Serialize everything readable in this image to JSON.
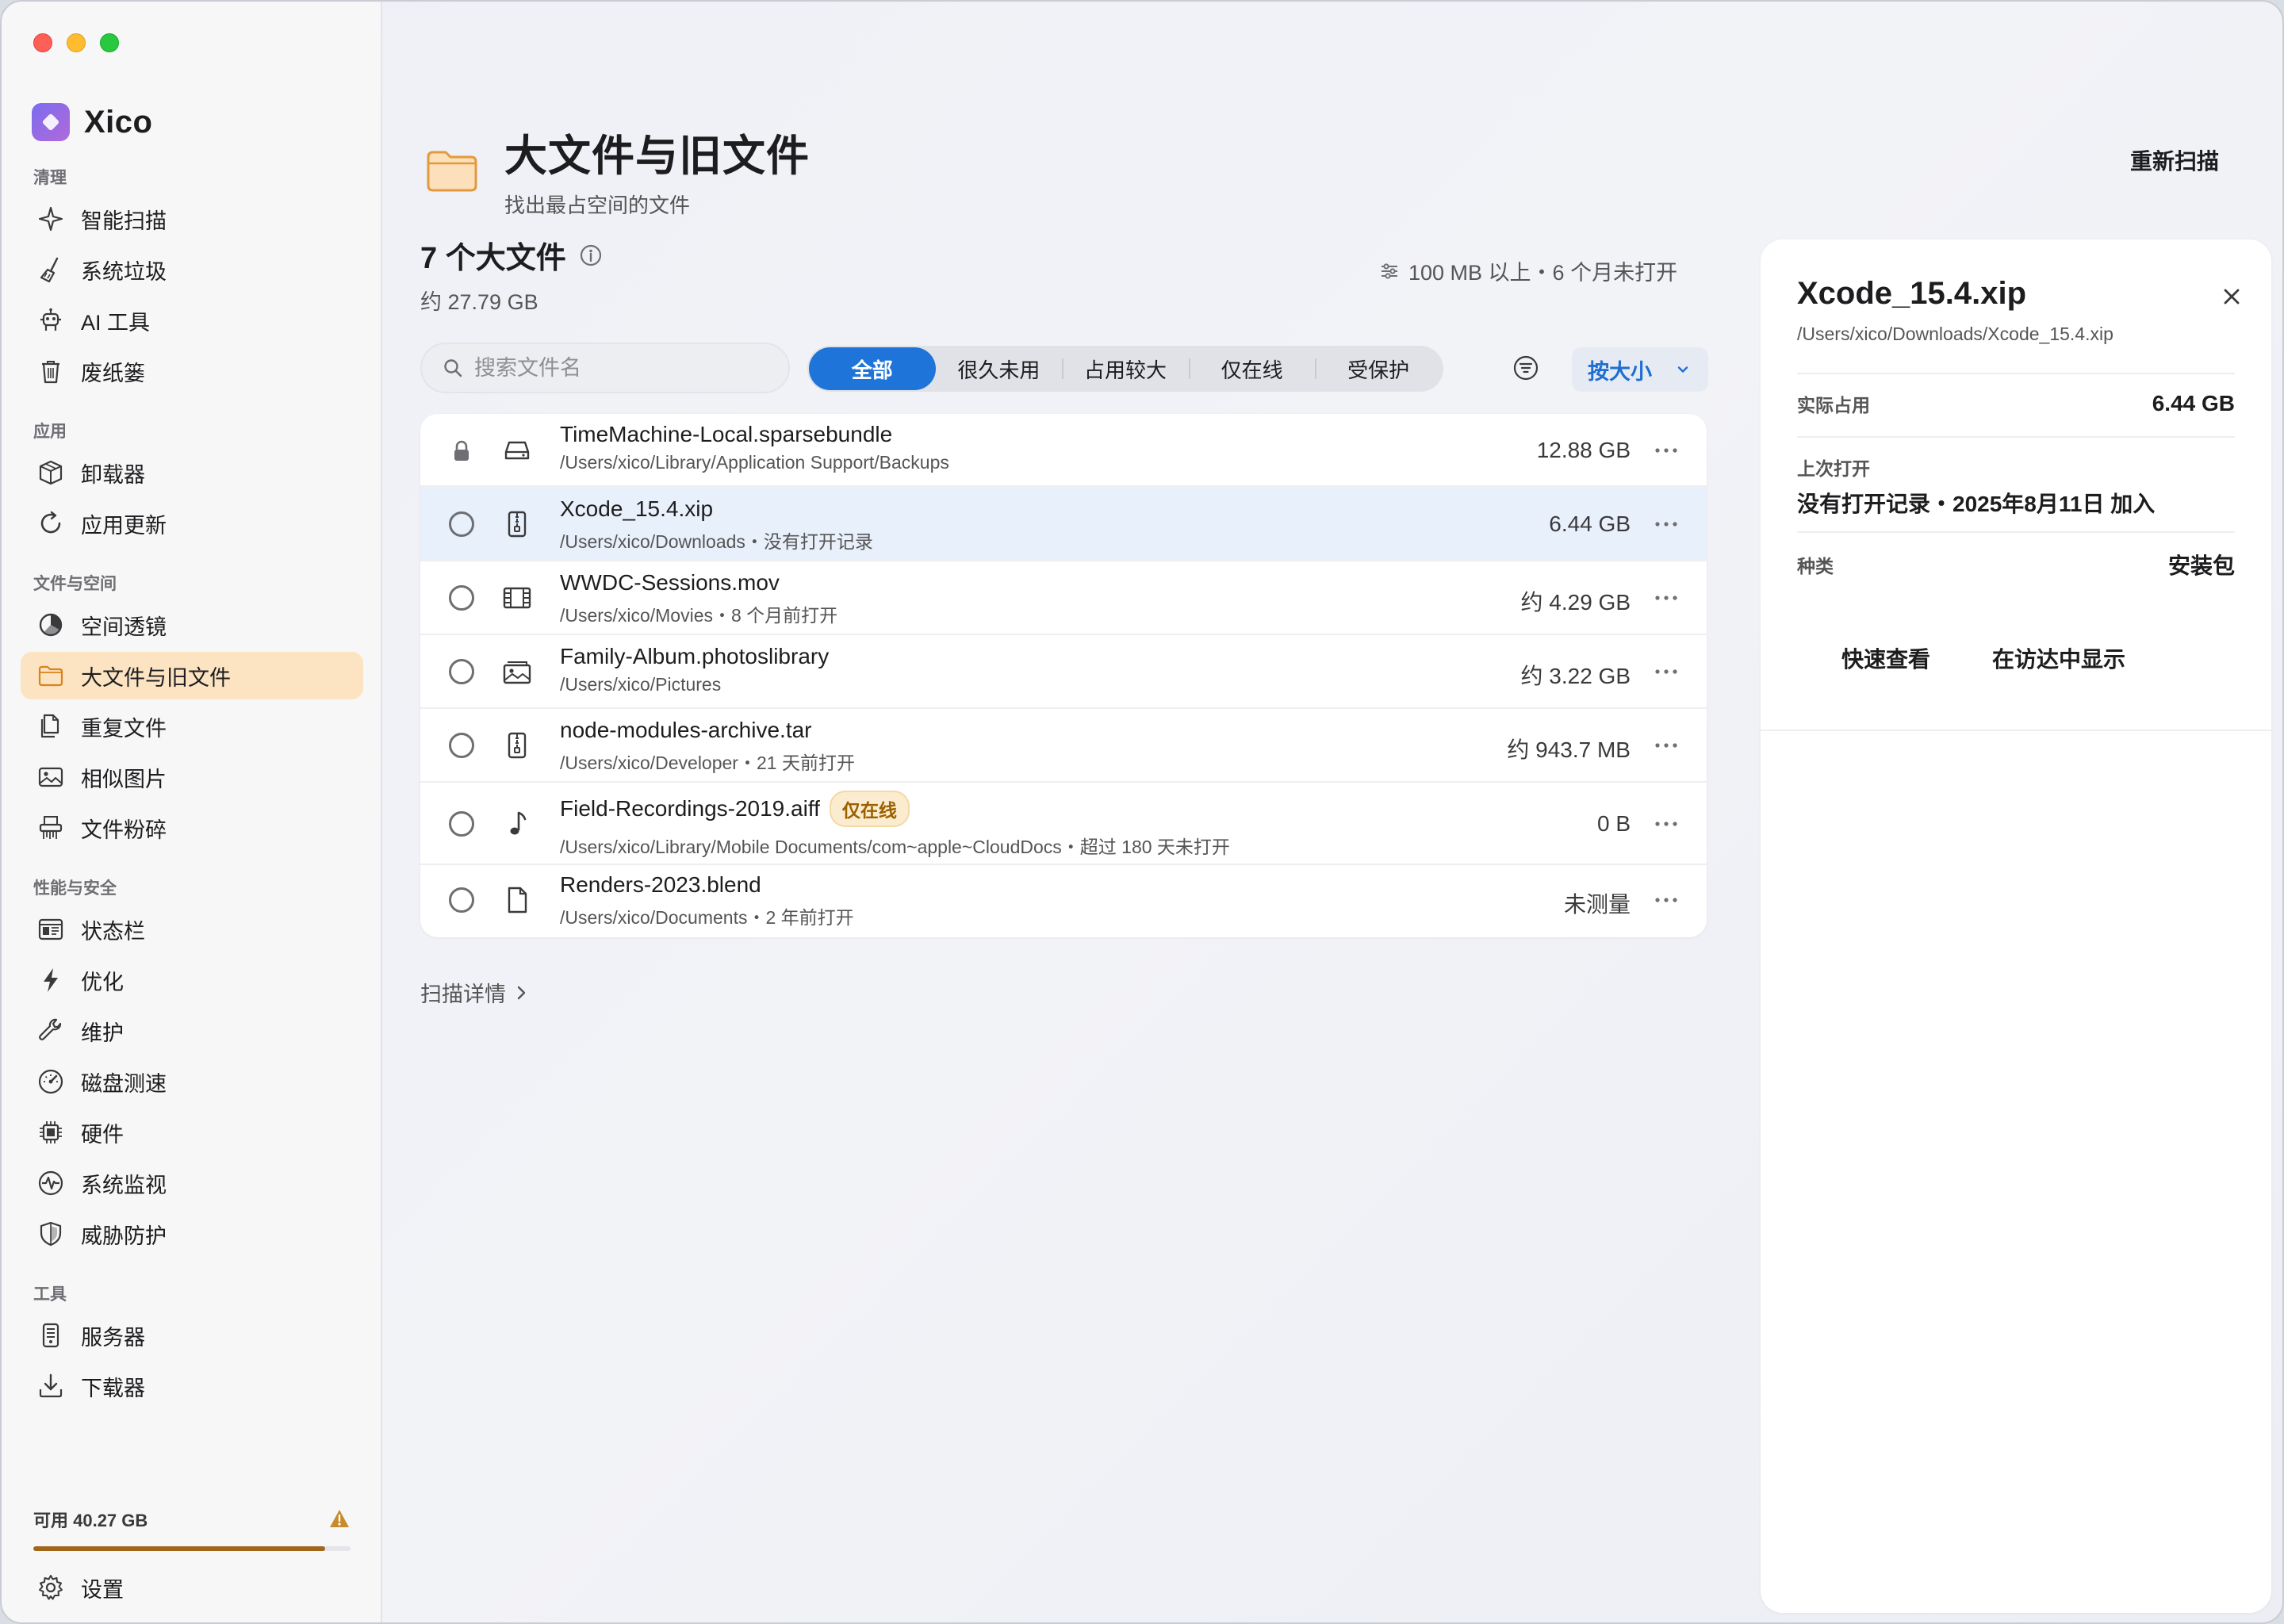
{
  "app": {
    "name": "Xico"
  },
  "sidebar": {
    "sections": [
      {
        "title": "清理",
        "items": [
          {
            "label": "智能扫描",
            "icon": "sparkle-icon"
          },
          {
            "label": "系统垃圾",
            "icon": "broom-icon"
          },
          {
            "label": "AI 工具",
            "icon": "robot-icon"
          },
          {
            "label": "废纸篓",
            "icon": "trash-icon"
          }
        ]
      },
      {
        "title": "应用",
        "items": [
          {
            "label": "卸载器",
            "icon": "box-icon"
          },
          {
            "label": "应用更新",
            "icon": "refresh-icon"
          }
        ]
      },
      {
        "title": "文件与空间",
        "items": [
          {
            "label": "空间透镜",
            "icon": "pie-chart-icon"
          },
          {
            "label": "大文件与旧文件",
            "icon": "folder-icon",
            "active": true
          },
          {
            "label": "重复文件",
            "icon": "duplicate-icon"
          },
          {
            "label": "相似图片",
            "icon": "photo-icon"
          },
          {
            "label": "文件粉碎",
            "icon": "shredder-icon"
          }
        ]
      },
      {
        "title": "性能与安全",
        "items": [
          {
            "label": "状态栏",
            "icon": "menubar-icon"
          },
          {
            "label": "优化",
            "icon": "bolt-icon"
          },
          {
            "label": "维护",
            "icon": "wrench-icon"
          },
          {
            "label": "磁盘测速",
            "icon": "gauge-icon"
          },
          {
            "label": "硬件",
            "icon": "chip-icon"
          },
          {
            "label": "系统监视",
            "icon": "pulse-icon"
          },
          {
            "label": "威胁防护",
            "icon": "shield-icon"
          }
        ]
      },
      {
        "title": "工具",
        "items": [
          {
            "label": "服务器",
            "icon": "server-icon"
          },
          {
            "label": "下载器",
            "icon": "download-icon"
          }
        ]
      }
    ],
    "storage": {
      "label": "可用 40.27 GB",
      "used_fraction": 0.92
    },
    "settings_label": "设置"
  },
  "header": {
    "title": "大文件与旧文件",
    "subtitle": "找出最占空间的文件",
    "rescan_label": "重新扫描"
  },
  "summary": {
    "title": "7 个大文件",
    "total_size": "约 27.79 GB",
    "criteria": "100 MB 以上・6 个月未打开"
  },
  "toolbar": {
    "search_placeholder": "搜索文件名",
    "segments": [
      "全部",
      "很久未用",
      "占用较大",
      "仅在线",
      "受保护"
    ],
    "active_segment": "全部",
    "sort_label": "按大小"
  },
  "files": [
    {
      "name": "TimeMachine-Local.sparsebundle",
      "path": "/Users/xico/Library/Application Support/Backups",
      "size": "12.88 GB",
      "icon": "drive-icon",
      "locked": true
    },
    {
      "name": "Xcode_15.4.xip",
      "path": "/Users/xico/Downloads・没有打开记录",
      "size": "6.44 GB",
      "icon": "archive-icon",
      "selected": true
    },
    {
      "name": "WWDC-Sessions.mov",
      "path": "/Users/xico/Movies・8 个月前打开",
      "size": "约 4.29 GB",
      "icon": "film-icon"
    },
    {
      "name": "Family-Album.photoslibrary",
      "path": "/Users/xico/Pictures",
      "size": "约 3.22 GB",
      "icon": "photos-icon"
    },
    {
      "name": "node-modules-archive.tar",
      "path": "/Users/xico/Developer・21 天前打开",
      "size": "约 943.7 MB",
      "icon": "archive-icon"
    },
    {
      "name": "Field-Recordings-2019.aiff",
      "badge": "仅在线",
      "path": "/Users/xico/Library/Mobile Documents/com~apple~CloudDocs・超过 180 天未打开",
      "size": "0 B",
      "icon": "music-note-icon"
    },
    {
      "name": "Renders-2023.blend",
      "path": "/Users/xico/Documents・2 年前打开",
      "size": "未测量",
      "icon": "document-icon"
    }
  ],
  "scan_detail_label": "扫描详情",
  "detail": {
    "name": "Xcode_15.4.xip",
    "path": "/Users/xico/Downloads/Xcode_15.4.xip",
    "actual_usage_label": "实际占用",
    "actual_usage": "6.44 GB",
    "last_opened_label": "上次打开",
    "last_opened": "没有打开记录・2025年8月11日 加入",
    "kind_label": "种类",
    "kind": "安装包",
    "quicklook_label": "快速查看",
    "reveal_label": "在访达中显示"
  }
}
